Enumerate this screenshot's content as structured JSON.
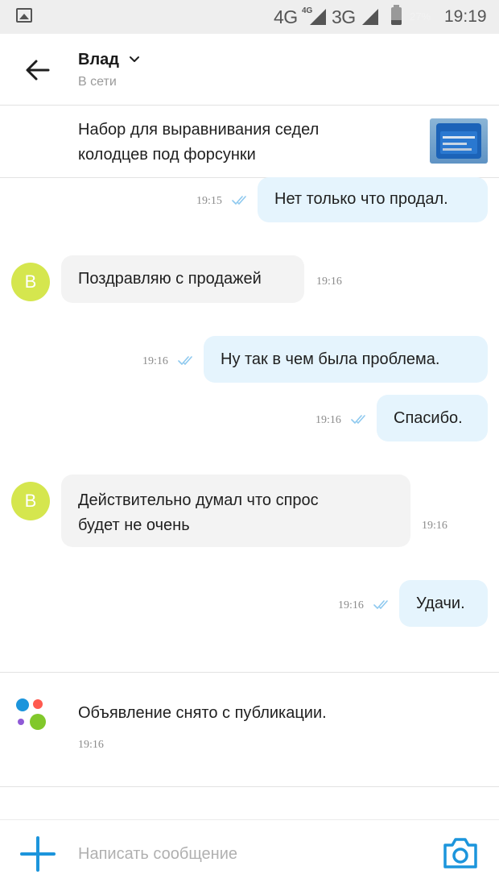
{
  "status_bar": {
    "network_1": "4G",
    "network_1_sup": "4G",
    "network_2": "3G",
    "battery": "27%",
    "time": "19:19"
  },
  "header": {
    "contact_name": "Влад",
    "contact_status": "В сети",
    "icons": [
      "arrow-left-icon",
      "chevron-down-icon"
    ]
  },
  "listing": {
    "title": "Набор для выравнивания седел\nколодцев под форсунки"
  },
  "messages": [
    {
      "direction": "outgoing",
      "text": "Нет только что продал.",
      "time": "19:15",
      "read": true
    },
    {
      "direction": "incoming",
      "avatar": "В",
      "text": "Поздравляю с продажей",
      "time": "19:16"
    },
    {
      "direction": "outgoing",
      "text": "Ну так в чем была проблема.",
      "time": "19:16",
      "read": true
    },
    {
      "direction": "outgoing",
      "text": "Спасибо.",
      "time": "19:16",
      "read": true
    },
    {
      "direction": "incoming",
      "avatar": "В",
      "text": "Действительно думал что спрос",
      "text_line2": "будет не очень",
      "time": "19:16"
    },
    {
      "direction": "outgoing",
      "text": "Удачи.",
      "time": "19:16",
      "read": true
    }
  ],
  "system_message": {
    "text": "Объявление снято с публикации.",
    "time": "19:16"
  },
  "composer": {
    "placeholder": "Написать сообщение",
    "value": ""
  },
  "colors": {
    "accent": "#1c95dc",
    "outgoing_bubble": "#e5f4fd",
    "incoming_bubble": "#f3f3f3",
    "avatar": "#d5e64e",
    "logo_dots": [
      "#1c95dc",
      "#ff5a4f",
      "#8f5ad6",
      "#81c82b"
    ]
  }
}
